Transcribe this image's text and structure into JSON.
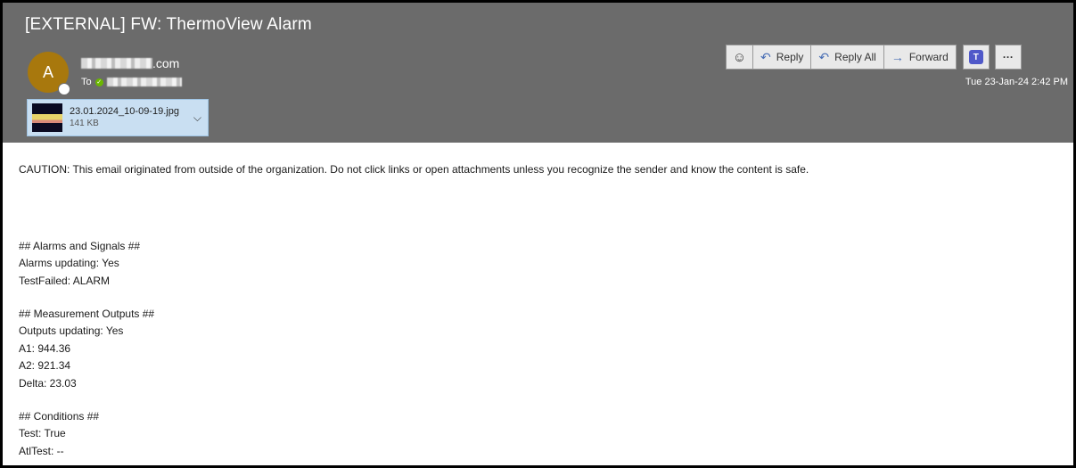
{
  "email": {
    "subject": "[EXTERNAL] FW: ThermoView Alarm",
    "avatar_initial": "A",
    "sender_suffix": ".com",
    "to_label": "To",
    "timestamp": "Tue 23-Jan-24 2:42 PM",
    "attachment": {
      "name": "23.01.2024_10-09-19.jpg",
      "size": "141 KB"
    }
  },
  "toolbar": {
    "reply_label": "Reply",
    "reply_all_label": "Reply All",
    "forward_label": "Forward",
    "more_label": "···"
  },
  "body": {
    "caution": "CAUTION: This email originated from outside of the organization. Do not click links or open attachments unless you recognize the sender and know the content is safe.",
    "sections": [
      {
        "header": "## Alarms and Signals ##",
        "lines": [
          "Alarms updating: Yes",
          "TestFailed: ALARM"
        ]
      },
      {
        "header": "## Measurement Outputs ##",
        "lines": [
          "Outputs updating: Yes",
          "A1: 944.36",
          "A2: 921.34",
          "Delta: 23.03"
        ]
      },
      {
        "header": "## Conditions ##",
        "lines": [
          "Test: True",
          "AtlTest: --"
        ]
      }
    ]
  },
  "colors": {
    "header_bg": "#6b6b6b",
    "avatar_bg": "#a8780d",
    "attachment_bg": "#c9dff2",
    "accent": "#4a6fb5"
  }
}
